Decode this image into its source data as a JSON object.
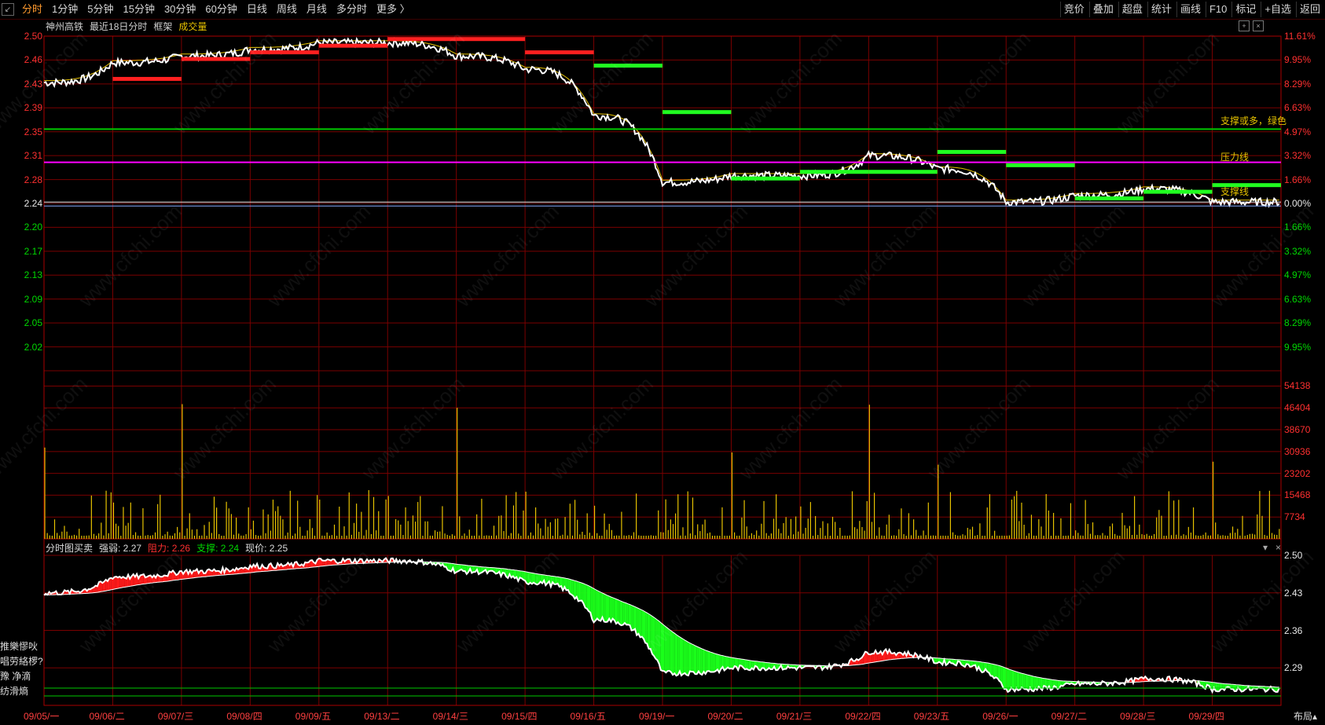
{
  "toolbar": {
    "corner_icon": "minimize-icon",
    "tabs": [
      "分时",
      "1分钟",
      "5分钟",
      "15分钟",
      "30分钟",
      "60分钟",
      "日线",
      "周线",
      "月线",
      "多分时",
      "更多 〉"
    ],
    "active_tab": 0,
    "right_buttons": [
      "竞价",
      "叠加",
      "超盘",
      "统计",
      "画线",
      "F10",
      "标记",
      "+自选",
      "返回"
    ]
  },
  "info": {
    "stock_name": "神州高铁",
    "range": "最近18日分时",
    "frame": "框架",
    "volume": "成交量"
  },
  "price_axis": {
    "left": [
      "2.50",
      "2.46",
      "2.43",
      "2.39",
      "2.35",
      "2.31",
      "2.28",
      "2.24",
      "2.20",
      "2.17",
      "2.13",
      "2.09",
      "2.05",
      "2.02"
    ],
    "right": [
      "11.61%",
      "9.95%",
      "8.29%",
      "6.63%",
      "4.97%",
      "3.32%",
      "1.66%",
      "0.00%",
      "1.66%",
      "3.32%",
      "4.97%",
      "6.63%",
      "8.29%",
      "9.95%"
    ]
  },
  "volume_axis": [
    "54138",
    "46404",
    "38670",
    "30936",
    "23202",
    "15468",
    "7734"
  ],
  "annotations": {
    "support_multi": "支撑或多，绿色",
    "pressure": "压力线",
    "support": "支撑线"
  },
  "indicator": {
    "name": "分时图买卖",
    "strength": "强弱: 2.27",
    "resistance": "阻力: 2.26",
    "support": "支撑: 2.24",
    "price": "现价: 2.25",
    "axis": [
      "2.50",
      "2.43",
      "2.36",
      "2.29"
    ],
    "left_notes": [
      "推樂憀吙",
      "唱劳絡椤?",
      "豫  净滴",
      "纺滑熵"
    ]
  },
  "dates": [
    "09/05/一",
    "09/06/二",
    "09/07/三",
    "09/08/四",
    "09/09/五",
    "09/13/二",
    "09/14/三",
    "09/15/四",
    "09/16/五",
    "09/19/一",
    "09/20/二",
    "09/21/三",
    "09/22/四",
    "09/23/五",
    "09/26/一",
    "09/27/二",
    "09/28/三",
    "09/29/四"
  ],
  "layout_button": "布局",
  "watermark": "www.cfchi.com",
  "chart_data": {
    "type": "line",
    "title": "神州高铁",
    "x": [
      "09/05",
      "09/06",
      "09/07",
      "09/08",
      "09/09",
      "09/13",
      "09/14",
      "09/15",
      "09/16",
      "09/19",
      "09/20",
      "09/21",
      "09/22",
      "09/23",
      "09/26",
      "09/27",
      "09/28",
      "09/29"
    ],
    "series": [
      {
        "values": [
          2.43,
          2.46,
          2.47,
          2.48,
          2.49,
          2.49,
          2.47,
          2.45,
          2.38,
          2.28,
          2.29,
          2.29,
          2.32,
          2.3,
          2.25,
          2.26,
          2.27,
          2.25
        ]
      }
    ],
    "ylim": [
      2.0,
      2.52
    ],
    "reference_lines": {
      "support_multi": 2.36,
      "pressure": 2.31,
      "support": 2.25
    },
    "colors": {
      "price": "#ffffff",
      "avg": "#e6c200",
      "grid": "#8b0000",
      "pressure": "#ff00ff",
      "support_multi": "#00c800"
    }
  }
}
